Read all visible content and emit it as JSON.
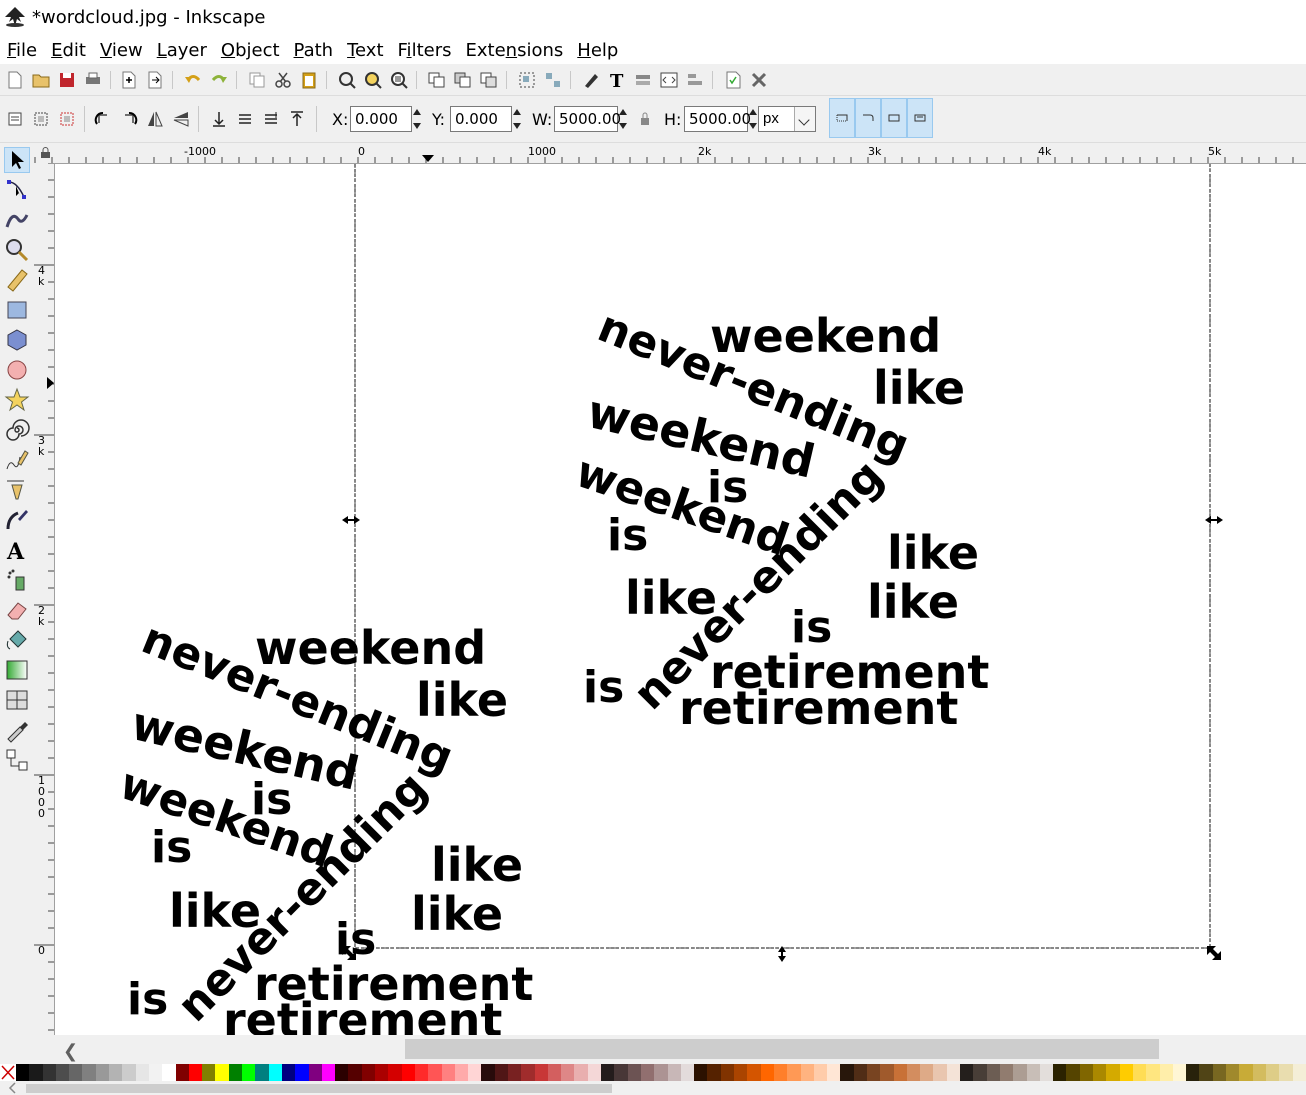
{
  "window": {
    "title": "*wordcloud.jpg - Inkscape"
  },
  "menu": [
    {
      "pre": "",
      "key": "F",
      "post": "ile"
    },
    {
      "pre": "",
      "key": "E",
      "post": "dit"
    },
    {
      "pre": "",
      "key": "V",
      "post": "iew"
    },
    {
      "pre": "",
      "key": "L",
      "post": "ayer"
    },
    {
      "pre": "",
      "key": "O",
      "post": "bject"
    },
    {
      "pre": "",
      "key": "P",
      "post": "ath"
    },
    {
      "pre": "",
      "key": "T",
      "post": "ext"
    },
    {
      "pre": "F",
      "key": "i",
      "post": "lters"
    },
    {
      "pre": "Exte",
      "key": "n",
      "post": "sions"
    },
    {
      "pre": "",
      "key": "H",
      "post": "elp"
    }
  ],
  "controls": {
    "x_label": "X:",
    "x_value": "0.000",
    "y_label": "Y:",
    "y_value": "0.000",
    "w_label": "W:",
    "w_value": "5000.00",
    "h_label": "H:",
    "h_value": "5000.00",
    "unit": "px"
  },
  "ruler_h": [
    "-1000",
    "0",
    "1000",
    "2k",
    "3k",
    "4k",
    "5k"
  ],
  "ruler_v": [
    "4\nk",
    "3\nk",
    "2\nk",
    "1\n0\n0\n0",
    "0"
  ],
  "words": {
    "weekend": "weekend",
    "never_ending": "never-ending",
    "like": "like",
    "is": "is",
    "retirement": "retirement"
  },
  "palette": [
    "#000000",
    "#1a1a1a",
    "#333333",
    "#4d4d4d",
    "#666666",
    "#808080",
    "#999999",
    "#b3b3b3",
    "#cccccc",
    "#e6e6e6",
    "#f2f2f2",
    "#ffffff",
    "#800000",
    "#ff0000",
    "#808000",
    "#ffff00",
    "#008000",
    "#00ff00",
    "#008080",
    "#00ffff",
    "#000080",
    "#0000ff",
    "#800080",
    "#ff00ff",
    "#2b0000",
    "#550000",
    "#800000",
    "#aa0000",
    "#d40000",
    "#ff0000",
    "#ff2a2a",
    "#ff5555",
    "#ff8080",
    "#ffaaaa",
    "#ffd5d5",
    "#280b0b",
    "#501616",
    "#782121",
    "#a02c2c",
    "#c83737",
    "#d35f5f",
    "#de8787",
    "#e9afaf",
    "#f4d7d7",
    "#241c1c",
    "#483737",
    "#6c5353",
    "#916f6f",
    "#ac9393",
    "#c8b7b7",
    "#e3dbdb",
    "#2b1100",
    "#552200",
    "#803300",
    "#aa4400",
    "#d45500",
    "#ff6600",
    "#ff7f2a",
    "#ff9955",
    "#ffb380",
    "#ffccaa",
    "#ffe6d5",
    "#28170b",
    "#502d16",
    "#784421",
    "#a05a2c",
    "#c87137",
    "#d38d5f",
    "#deaa87",
    "#e9c6af",
    "#f4e3d7",
    "#241f1c",
    "#483e37",
    "#6c5d53",
    "#917c6f",
    "#ac9d93",
    "#c8beb7",
    "#e3dedb",
    "#2b2200",
    "#554400",
    "#806600",
    "#aa8800",
    "#d4aa00",
    "#ffcc00",
    "#ffdd55",
    "#ffe680",
    "#ffeeaa",
    "#fff6d5",
    "#28220b",
    "#504416",
    "#786721",
    "#a0892c",
    "#c8ab37",
    "#d3bc5f",
    "#decd87",
    "#e9ddaf",
    "#f4eed7"
  ]
}
